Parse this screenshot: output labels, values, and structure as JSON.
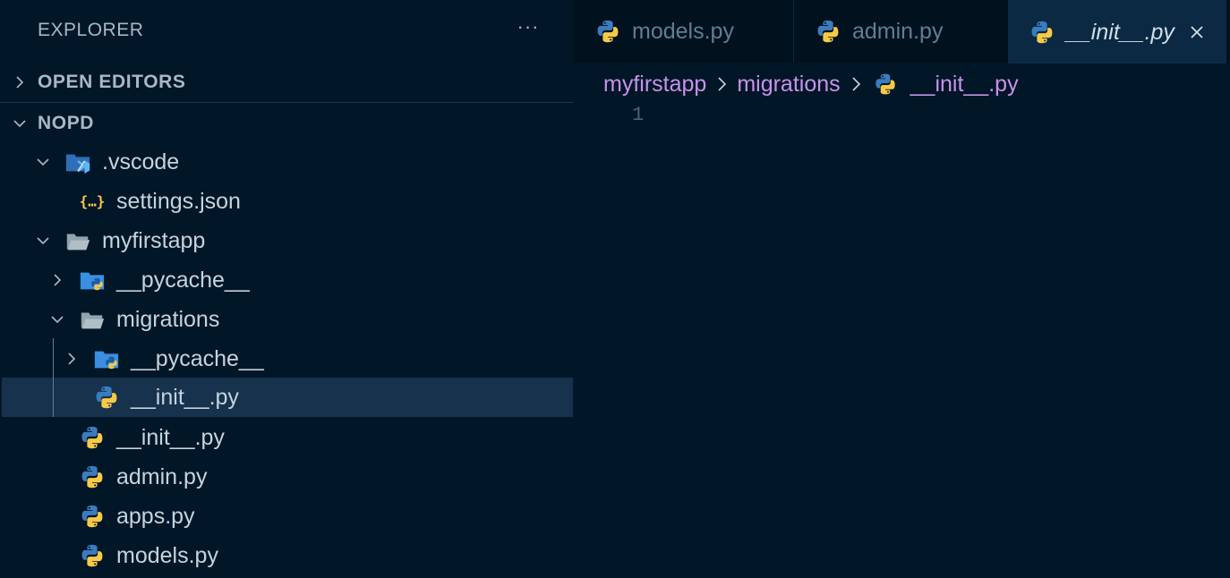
{
  "sidebar": {
    "title": "EXPLORER",
    "more_label": "···",
    "open_editors_label": "OPEN EDITORS",
    "root_label": "NOPD",
    "tree": [
      {
        "label": ".vscode",
        "icon": "vscode-folder-icon",
        "expanded": true
      },
      {
        "label": "settings.json",
        "icon": "json-file-icon"
      },
      {
        "label": "myfirstapp",
        "icon": "folder-open-icon",
        "expanded": true
      },
      {
        "label": "__pycache__",
        "icon": "python-folder-icon",
        "expanded": false
      },
      {
        "label": "migrations",
        "icon": "folder-open-icon",
        "expanded": true
      },
      {
        "label": "__pycache__",
        "icon": "python-folder-icon",
        "expanded": false
      },
      {
        "label": "__init__.py",
        "icon": "python-file-icon",
        "selected": true
      },
      {
        "label": "__init__.py",
        "icon": "python-file-icon"
      },
      {
        "label": "admin.py",
        "icon": "python-file-icon"
      },
      {
        "label": "apps.py",
        "icon": "python-file-icon"
      },
      {
        "label": "models.py",
        "icon": "python-file-icon"
      }
    ]
  },
  "tabs": [
    {
      "label": "models.py",
      "icon": "python-file-icon",
      "active": false
    },
    {
      "label": "admin.py",
      "icon": "python-file-icon",
      "active": false
    },
    {
      "label": "__init__.py",
      "icon": "python-file-icon",
      "active": true
    }
  ],
  "breadcrumb": {
    "parts": [
      "myfirstapp",
      "migrations"
    ],
    "file": "__init__.py"
  },
  "editor": {
    "line_numbers": [
      "1"
    ]
  },
  "colors": {
    "background": "#011627",
    "selection": "#16324d",
    "breadcrumb": "#c792ea",
    "python_blue": "#3b7bbf",
    "python_yellow": "#f7c948"
  }
}
